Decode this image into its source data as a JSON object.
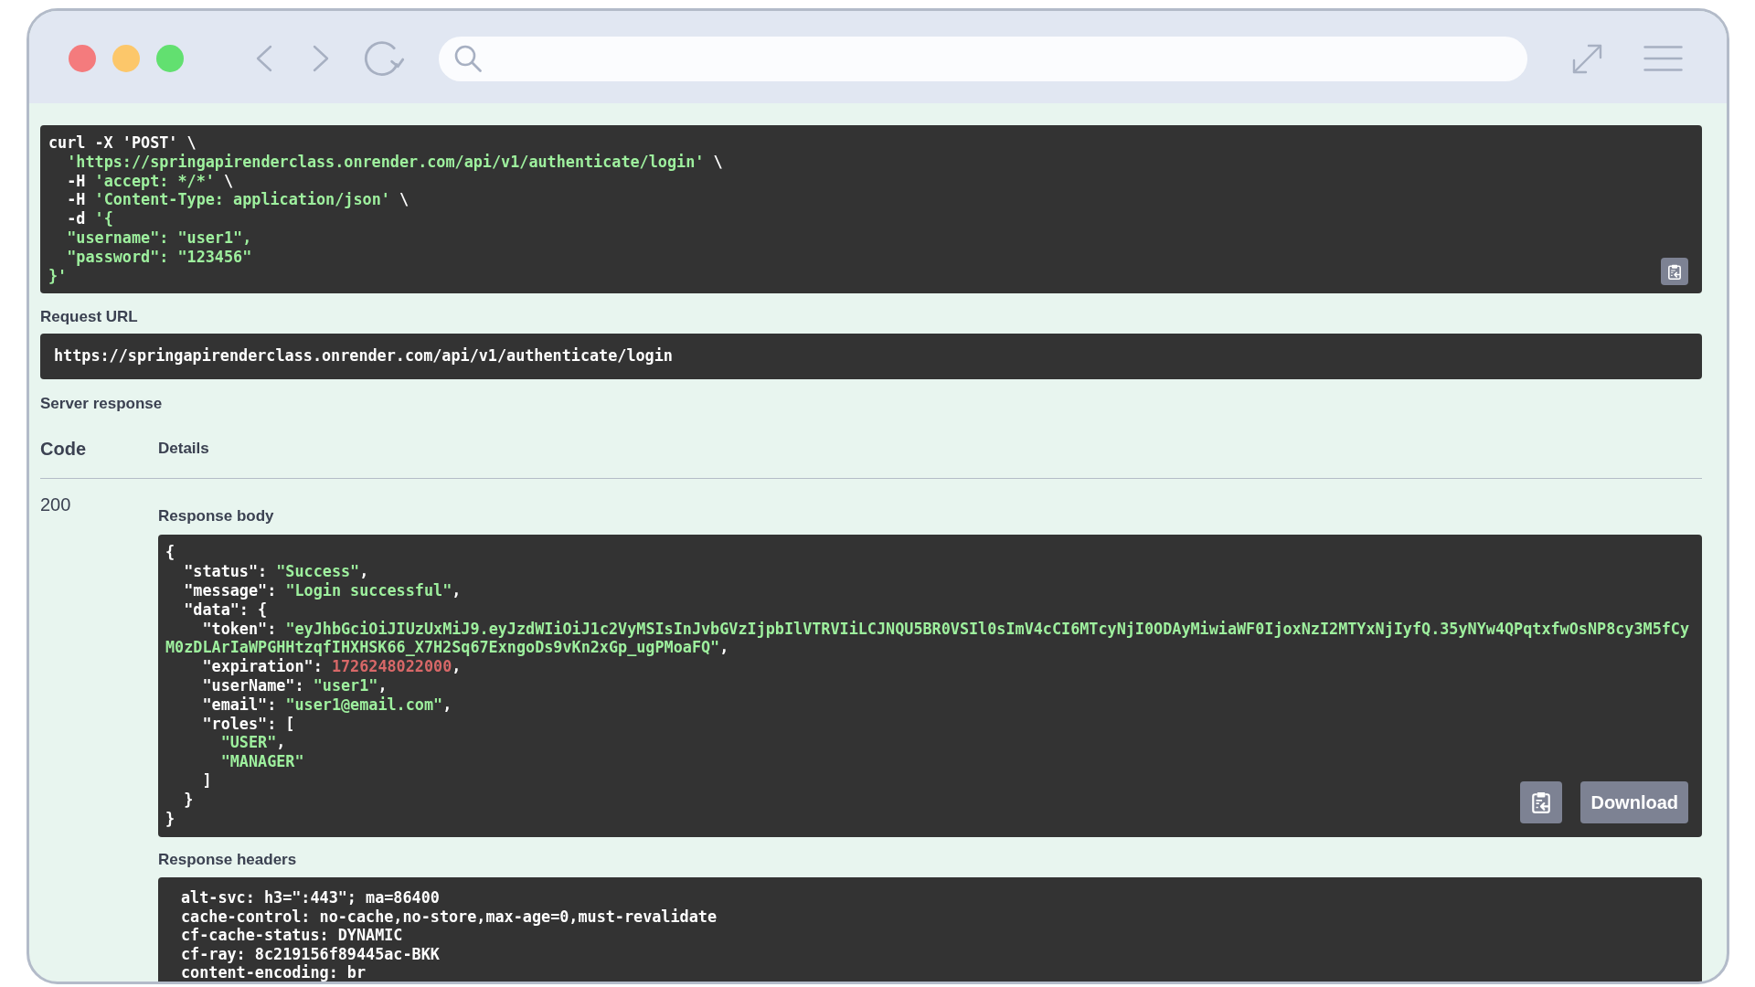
{
  "curl_command": {
    "lines": [
      {
        "segments": [
          {
            "text": "curl -X 'POST' \\",
            "kind": "plain"
          }
        ]
      },
      {
        "segments": [
          {
            "text": "  'https://springapirenderclass.onrender.com/api/v1/authenticate/login'",
            "kind": "string"
          },
          {
            "text": " \\",
            "kind": "plain"
          }
        ]
      },
      {
        "segments": [
          {
            "text": "  -H ",
            "kind": "plain"
          },
          {
            "text": "'accept: */*'",
            "kind": "string"
          },
          {
            "text": " \\",
            "kind": "plain"
          }
        ]
      },
      {
        "segments": [
          {
            "text": "  -H ",
            "kind": "plain"
          },
          {
            "text": "'Content-Type: application/json'",
            "kind": "string"
          },
          {
            "text": " \\",
            "kind": "plain"
          }
        ]
      },
      {
        "segments": [
          {
            "text": "  -d ",
            "kind": "plain"
          },
          {
            "text": "'{",
            "kind": "string"
          }
        ]
      },
      {
        "segments": [
          {
            "text": "  \"username\": \"user1\",",
            "kind": "string"
          }
        ]
      },
      {
        "segments": [
          {
            "text": "  \"password\": \"123456\"",
            "kind": "string"
          }
        ]
      },
      {
        "segments": [
          {
            "text": "}'",
            "kind": "string"
          }
        ]
      }
    ]
  },
  "request_url": {
    "label": "Request URL",
    "url": "https://springapirenderclass.onrender.com/api/v1/authenticate/login"
  },
  "server_response": {
    "label": "Server response",
    "columns": [
      "Code",
      "Details"
    ],
    "code": "200",
    "body": {
      "label": "Response body",
      "lines": [
        "{",
        "  \"status\": \"Success\",",
        "  \"message\": \"Login successful\",",
        "  \"data\": {",
        "    \"token\": \"eyJhbGciOiJIUzUxMiJ9.eyJzdWIiOiJ1c2VyMSIsInJvbGVzIjpbIlVTRVIiLCJNQU5BR0VSIl0sImV4cCI6MTcyNjI0ODAyMiwiaWF0IjoxNzI2MTYxNjIyfQ.35yNYw4QPqtxfwOsNP8cy3M5fCyM0zDLArIaWPGHHtzqfIHXHSK66_X7H2Sq67ExngoDs9vKn2xGp_ugPMoaFQ\",",
        "    \"expiration\": 1726248022000,",
        "    \"userName\": \"user1\",",
        "    \"email\": \"user1@email.com\",",
        "    \"roles\": [",
        "      \"USER\",",
        "      \"MANAGER\"",
        "    ]",
        "  }",
        "}"
      ],
      "download_button": "Download"
    },
    "headers": {
      "label": "Response headers",
      "lines": [
        "alt-svc: h3=\":443\"; ma=86400",
        "cache-control: no-cache,no-store,max-age=0,must-revalidate",
        "cf-cache-status: DYNAMIC",
        "cf-ray: 8c219156f89445ac-BKK",
        "content-encoding: br"
      ]
    }
  }
}
